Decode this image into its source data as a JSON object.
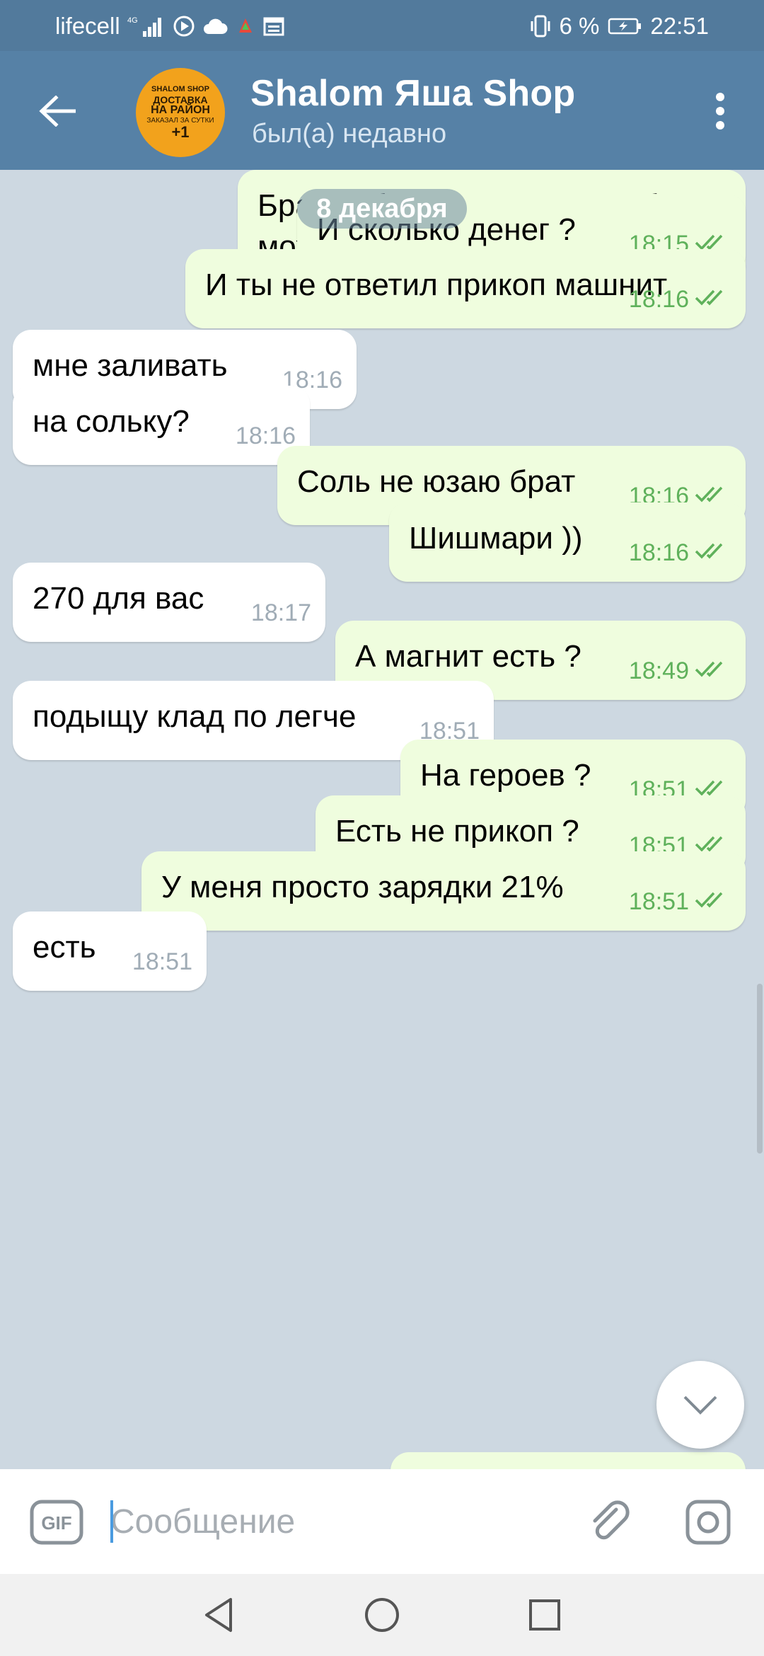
{
  "status_bar": {
    "carrier": "lifecell",
    "network": "4G",
    "battery_percent": "6 %",
    "time": "22:51"
  },
  "header": {
    "title": "Shalom Яша Shop",
    "subtitle": "был(а) недавно",
    "avatar_text": [
      "SHALOM SHOP",
      "ДОСТАВКА",
      "НА РАЙОН",
      "ЗАКАЗАЛ ЗА СУТКИ",
      "+1"
    ]
  },
  "date_separator": "8 декабря",
  "messages": [
    {
      "dir": "out",
      "text": "Братан боту залить или тебе можно ?",
      "time": "18:15",
      "read": true
    },
    {
      "dir": "out",
      "text": "И сколько денег ?",
      "time": "18:15",
      "read": true
    },
    {
      "dir": "out",
      "text": "И ты не ответил прикоп машнит",
      "time": "18:16",
      "read": true
    },
    {
      "dir": "in",
      "text": "мне заливать",
      "time": "18:16"
    },
    {
      "dir": "in",
      "text": "на сольку?",
      "time": "18:16"
    },
    {
      "dir": "out",
      "text": "Соль не юзаю брат",
      "time": "18:16",
      "read": true
    },
    {
      "dir": "out",
      "text": "Шишмари ))",
      "time": "18:16",
      "read": true
    },
    {
      "dir": "in",
      "text": "270 для вас",
      "time": "18:17"
    },
    {
      "dir": "out",
      "text": "А магнит есть ?",
      "time": "18:49",
      "read": true
    },
    {
      "dir": "in",
      "text": "подыщу клад по легче",
      "time": "18:51"
    },
    {
      "dir": "out",
      "text": "На героев ?",
      "time": "18:51",
      "read": true
    },
    {
      "dir": "out",
      "text": "Есть не прикоп ?",
      "time": "18:51",
      "read": true
    },
    {
      "dir": "out",
      "text": "У меня просто зарядки 21%",
      "time": "18:51",
      "read": true
    },
    {
      "dir": "in",
      "text": "есть",
      "time": "18:51"
    }
  ],
  "composer": {
    "placeholder": "Сообщение",
    "value": ""
  },
  "icons": {
    "back": "arrow-left-icon",
    "menu": "more-vertical-icon",
    "gif": "gif-icon",
    "attach": "paperclip-icon",
    "camera": "camera-icon",
    "scroll_down": "chevron-down-icon",
    "read_receipt": "double-check-icon"
  },
  "colors": {
    "header": "#5681a6",
    "outgoing_bubble": "#effdde",
    "incoming_bubble": "#ffffff",
    "check": "#5fb15b",
    "chat_bg": "#cdd8e1"
  }
}
